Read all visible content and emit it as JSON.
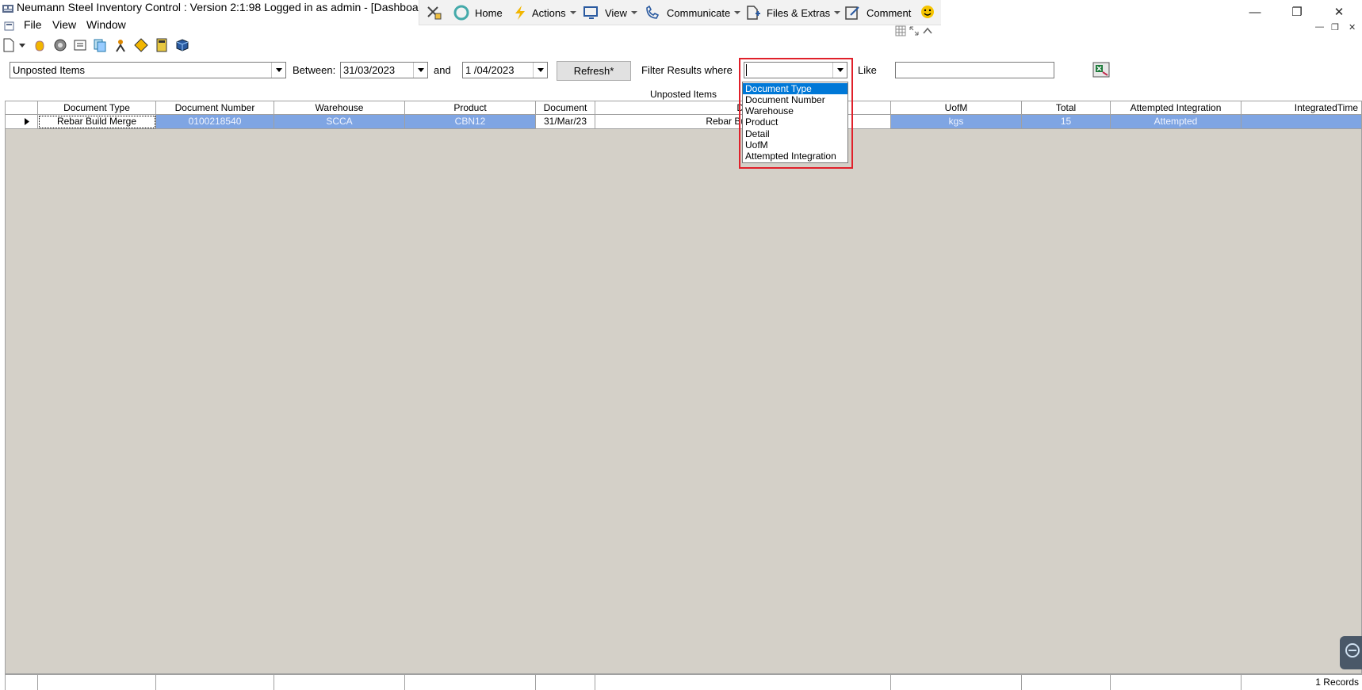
{
  "window": {
    "title": "Neumann Steel Inventory Control : Version 2:1:98 Logged in as admin - [Dashboard]"
  },
  "cmdbar": {
    "home": "Home",
    "actions": "Actions",
    "view": "View",
    "communicate": "Communicate",
    "files": "Files & Extras",
    "comment": "Comment"
  },
  "menu": {
    "file": "File",
    "view": "View",
    "window": "Window"
  },
  "filter": {
    "report_selected": "Unposted Items",
    "between_label": "Between:",
    "date_from": "31/03/2023",
    "and_label": "and",
    "date_to": "1 /04/2023",
    "refresh_label": "Refresh*",
    "filter_where_label": "Filter Results where",
    "filter_field_value": "",
    "like_label": "Like",
    "like_value": ""
  },
  "dropdown": {
    "options": [
      "Document Type",
      "Document Number",
      "Warehouse",
      "Product",
      "Detail",
      "UofM",
      "Attempted Integration"
    ],
    "highlighted_index": 0
  },
  "grid": {
    "caption": "Unposted Items",
    "columns": [
      "Document Type",
      "Document Number",
      "Warehouse",
      "Product",
      "Document",
      "De",
      "UofM",
      "Total",
      "Attempted Integration",
      "IntegratedTime"
    ],
    "rows": [
      {
        "document_type": "Rebar Build Merge",
        "document_number": "0100218540",
        "warehouse": "SCCA",
        "product": "CBN12",
        "document": "31/Mar/23",
        "detail": "Rebar Build Merg",
        "uofm": "kgs",
        "total": "15",
        "attempted": "Attempted",
        "integrated_time": ""
      }
    ]
  },
  "status": {
    "records": "1 Records"
  },
  "colors": {
    "selection": "#7fa5e3",
    "highlight": "#0078d7",
    "annotation_red": "#e0202a",
    "grid_background": "#d4d0c8"
  }
}
